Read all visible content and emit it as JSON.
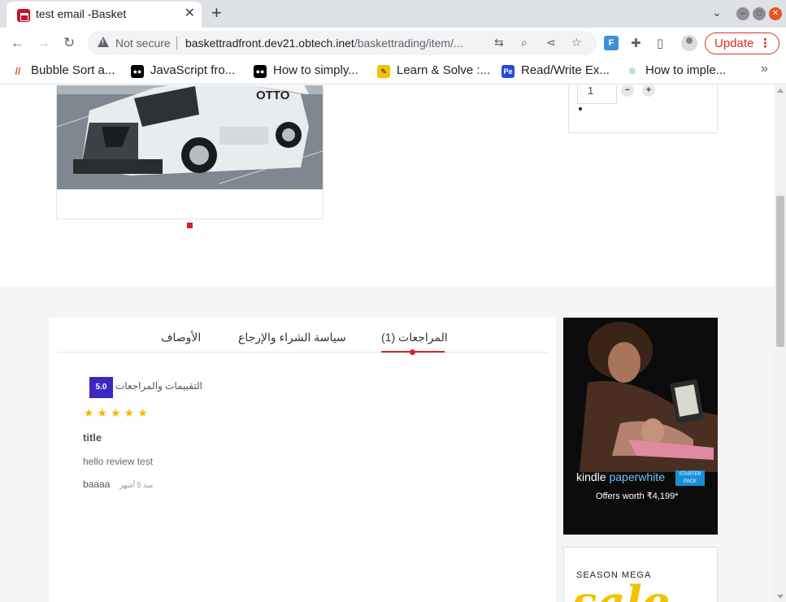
{
  "browser": {
    "tab_title": "test email -Basket",
    "tab_close": "✕",
    "new_tab": "+",
    "security_label": "Not secure",
    "url_host": "baskettradfront.dev21.obtech.inet",
    "url_path": "/baskettrading/item/...",
    "update_label": "Update",
    "extension_letter": "F"
  },
  "bookmarks": [
    {
      "label": "Bubble Sort a...",
      "icon": "bubble-sort-icon",
      "color": "#e8471e"
    },
    {
      "label": "JavaScript fro...",
      "icon": "medium-icon",
      "color": "#000000"
    },
    {
      "label": "How to simply...",
      "icon": "medium-icon",
      "color": "#000000"
    },
    {
      "label": "Learn & Solve :...",
      "icon": "pencil-icon",
      "color": "#f2c200"
    },
    {
      "label": "Read/Write Ex...",
      "icon": "pe-icon",
      "color": "#2a4ad8"
    },
    {
      "label": "How to imple...",
      "icon": "molecule-icon",
      "color": "#1db6a8"
    }
  ],
  "product": {
    "quantity": "1",
    "qty_minus": "−",
    "qty_plus": "+",
    "truck_logo": "OTTO"
  },
  "tabs": {
    "reviews": "المراجعات (1)",
    "policy": "سياسة الشراء والإرجاع",
    "descriptions": "الأوصاف"
  },
  "reviews": {
    "rating": "5.0",
    "rating_label": "التقييمات والمراجعات",
    "stars": "★★★★★",
    "star_count": 5,
    "title": "title",
    "body": "hello review test",
    "author": "baaaa",
    "time": "منذ 5 أشهر"
  },
  "ads": {
    "kindle_brand": "kindle",
    "kindle_product": "paperwhite",
    "kindle_badge": "STARTER PACK",
    "kindle_offer": "Offers worth ₹4,199*",
    "sale_label": "SEASON MEGA",
    "sale_word": "sale"
  },
  "colors": {
    "accent_red": "#d4222a",
    "rating_badge": "#3b28c3",
    "star_yellow": "#f5b800",
    "update_red": "#d93025"
  }
}
